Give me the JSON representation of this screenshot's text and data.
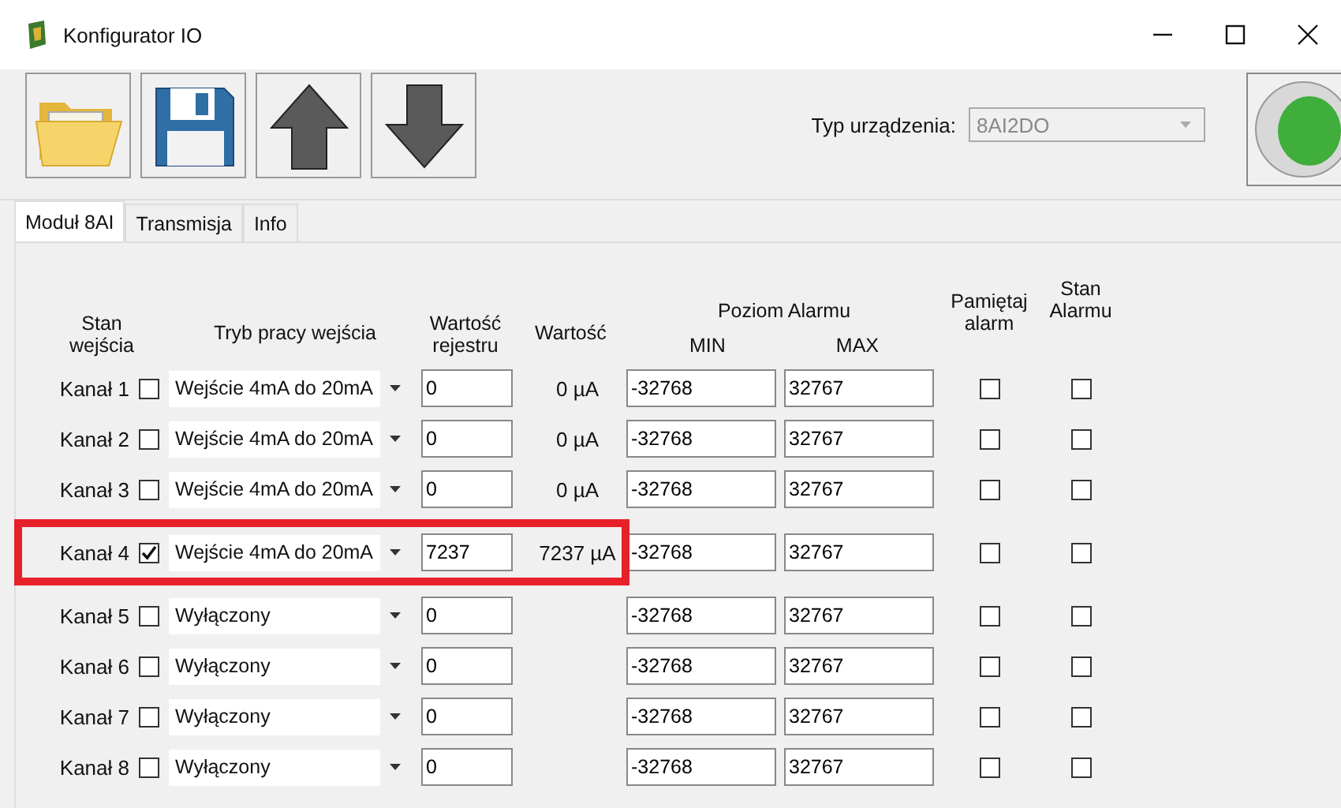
{
  "window": {
    "title": "Konfigurator IO"
  },
  "device_type": {
    "label": "Typ urządzenia:",
    "value": "8AI2DO",
    "disabled": true
  },
  "status_led": {
    "on": true
  },
  "tabs": [
    {
      "label": "Moduł 8AI",
      "selected": true
    },
    {
      "label": "Transmisja",
      "selected": false
    },
    {
      "label": "Info",
      "selected": false
    }
  ],
  "headers": {
    "input_state": "Stan wejścia",
    "input_mode": "Tryb pracy wejścia",
    "register_value": "Wartość rejestru",
    "value": "Wartość",
    "alarm_level": "Poziom Alarmu",
    "min": "MIN",
    "max": "MAX",
    "remember_alarm": "Pamiętaj alarm",
    "alarm_state": "Stan Alarmu"
  },
  "channels": [
    {
      "label": "Kanał 1",
      "enabled": false,
      "mode": "Wejście 4mA do 20mA",
      "register": "0",
      "value": "0 µA",
      "min": "-32768",
      "max": "32767",
      "remember_alarm": false,
      "alarm_state": false,
      "highlighted": false
    },
    {
      "label": "Kanał 2",
      "enabled": false,
      "mode": "Wejście 4mA do 20mA",
      "register": "0",
      "value": "0 µA",
      "min": "-32768",
      "max": "32767",
      "remember_alarm": false,
      "alarm_state": false,
      "highlighted": false
    },
    {
      "label": "Kanał 3",
      "enabled": false,
      "mode": "Wejście 4mA do 20mA",
      "register": "0",
      "value": "0 µA",
      "min": "-32768",
      "max": "32767",
      "remember_alarm": false,
      "alarm_state": false,
      "highlighted": false
    },
    {
      "label": "Kanał 4",
      "enabled": true,
      "mode": "Wejście 4mA do 20mA",
      "register": "7237",
      "value": "7237 µA",
      "min": "-32768",
      "max": "32767",
      "remember_alarm": false,
      "alarm_state": false,
      "highlighted": true
    },
    {
      "label": "Kanał 5",
      "enabled": false,
      "mode": "Wyłączony",
      "register": "0",
      "min": "-32768",
      "max": "32767",
      "remember_alarm": false,
      "alarm_state": false,
      "highlighted": false
    },
    {
      "label": "Kanał 6",
      "enabled": false,
      "mode": "Wyłączony",
      "register": "0",
      "min": "-32768",
      "max": "32767",
      "remember_alarm": false,
      "alarm_state": false,
      "highlighted": false
    },
    {
      "label": "Kanał 7",
      "enabled": false,
      "mode": "Wyłączony",
      "register": "0",
      "min": "-32768",
      "max": "32767",
      "remember_alarm": false,
      "alarm_state": false,
      "highlighted": false
    },
    {
      "label": "Kanał 8",
      "enabled": false,
      "mode": "Wyłączony",
      "register": "0",
      "min": "-32768",
      "max": "32767",
      "remember_alarm": false,
      "alarm_state": false,
      "highlighted": false
    }
  ]
}
